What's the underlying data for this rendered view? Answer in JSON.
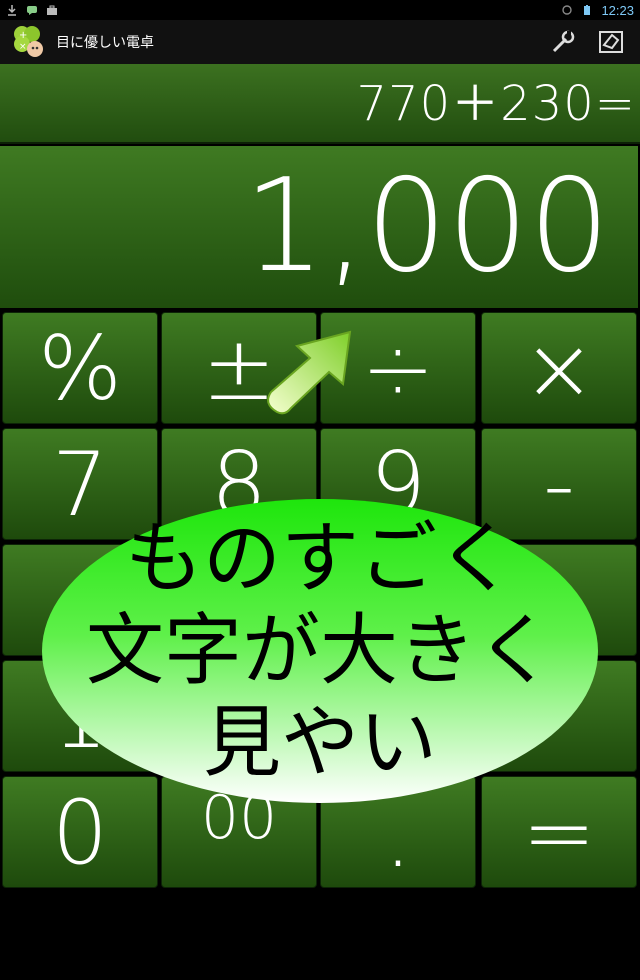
{
  "status_bar": {
    "time": "12:23",
    "left_icons": [
      "download-icon",
      "chat-icon",
      "briefcase-icon"
    ],
    "right_icons": [
      "rotate-icon",
      "battery-icon"
    ]
  },
  "action_bar": {
    "app_title": "目に優しい電卓",
    "actions": [
      "settings-icon",
      "eraser-icon"
    ]
  },
  "display": {
    "expression": "770＋230=",
    "result": "1,000"
  },
  "keypad": {
    "keys": [
      {
        "label": "%",
        "name": "percent"
      },
      {
        "label": "±",
        "name": "plus-minus"
      },
      {
        "label": "÷",
        "name": "divide"
      },
      {
        "label": "×",
        "name": "multiply"
      },
      {
        "label": "7",
        "name": "digit-7"
      },
      {
        "label": "8",
        "name": "digit-8"
      },
      {
        "label": "9",
        "name": "digit-9"
      },
      {
        "label": "-",
        "name": "minus"
      },
      {
        "label": "",
        "name": "digit-4"
      },
      {
        "label": "",
        "name": "digit-5"
      },
      {
        "label": "",
        "name": "digit-6"
      },
      {
        "label": "",
        "name": "plus"
      },
      {
        "label": "1",
        "name": "digit-1"
      },
      {
        "label": "",
        "name": "digit-2"
      },
      {
        "label": "",
        "name": "digit-3"
      },
      {
        "label": "",
        "name": "blank"
      },
      {
        "label": "0",
        "name": "digit-0"
      },
      {
        "label": "00",
        "name": "double-zero"
      },
      {
        "label": ".",
        "name": "decimal"
      },
      {
        "label": "=",
        "name": "equals"
      }
    ]
  },
  "promo": {
    "lines": [
      "ものすごく",
      "文字が大きく",
      "見やい"
    ]
  },
  "colors": {
    "key_top": "#3f7b22",
    "key_bottom": "#1e4a0c",
    "bubble_green": "#22ee11",
    "status_time": "#7ec8f5"
  }
}
